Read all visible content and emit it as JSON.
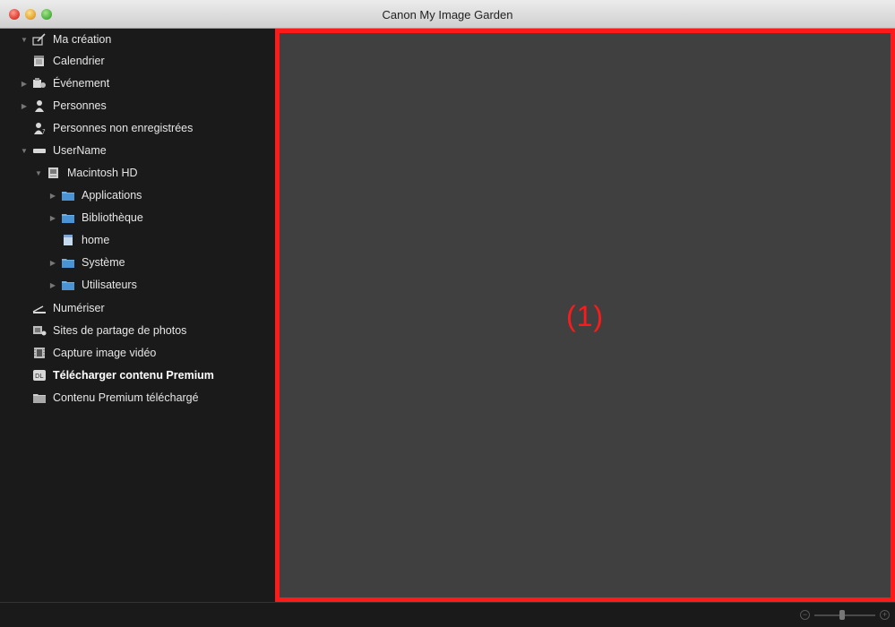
{
  "window": {
    "title": "Canon My Image Garden"
  },
  "sidebar": {
    "items": [
      {
        "label": "Ma création",
        "icon": "my-art-icon",
        "disclosure": "▼"
      },
      {
        "label": "Calendrier",
        "icon": "calendar-icon",
        "disclosure": ""
      },
      {
        "label": "Événement",
        "icon": "event-icon",
        "disclosure": "▶"
      },
      {
        "label": "Personnes",
        "icon": "person-icon",
        "disclosure": "▶"
      },
      {
        "label": "Personnes non enregistrées",
        "icon": "unregistered-person-icon",
        "disclosure": ""
      },
      {
        "label": "UserName",
        "icon": "drive-icon",
        "disclosure": "▼"
      },
      {
        "label": "Macintosh HD",
        "icon": "hard-disk-icon",
        "disclosure": "▼"
      },
      {
        "label": "Applications",
        "icon": "folder-icon",
        "disclosure": "▶"
      },
      {
        "label": "Bibliothèque",
        "icon": "folder-icon",
        "disclosure": "▶"
      },
      {
        "label": "home",
        "icon": "document-icon",
        "disclosure": ""
      },
      {
        "label": "Système",
        "icon": "folder-icon",
        "disclosure": "▶"
      },
      {
        "label": "Utilisateurs",
        "icon": "folder-icon",
        "disclosure": "▶"
      },
      {
        "label": "Numériser",
        "icon": "scan-icon",
        "disclosure": ""
      },
      {
        "label": "Sites de partage de photos",
        "icon": "photo-sharing-icon",
        "disclosure": ""
      },
      {
        "label": "Capture image vidéo",
        "icon": "video-capture-icon",
        "disclosure": ""
      },
      {
        "label": "Télécharger contenu Premium",
        "icon": "premium-download-icon",
        "disclosure": ""
      },
      {
        "label": "Contenu Premium téléchargé",
        "icon": "premium-folder-icon",
        "disclosure": ""
      }
    ]
  },
  "main": {
    "callout": "(1)"
  },
  "bottombar": {
    "zoom_minus": "−",
    "zoom_plus": "+"
  },
  "colors": {
    "highlight": "#ff1a1a",
    "sidebar_bg": "#1a1a1a",
    "main_bg": "#404040"
  }
}
